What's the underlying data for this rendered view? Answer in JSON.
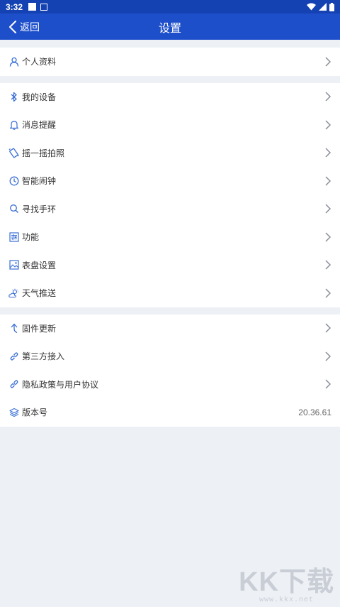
{
  "status_bar": {
    "time": "3:32"
  },
  "header": {
    "back_label": "返回",
    "title": "设置"
  },
  "groups": [
    {
      "items": [
        {
          "label": "个人资料",
          "icon": "person-icon"
        }
      ]
    },
    {
      "items": [
        {
          "label": "我的设备",
          "icon": "bluetooth-icon"
        },
        {
          "label": "消息提醒",
          "icon": "bell-icon"
        },
        {
          "label": "摇一摇拍照",
          "icon": "shake-phone-icon"
        },
        {
          "label": "智能闹钟",
          "icon": "clock-icon"
        },
        {
          "label": "寻找手环",
          "icon": "search-icon"
        },
        {
          "label": "功能",
          "icon": "sliders-icon"
        },
        {
          "label": "表盘设置",
          "icon": "picture-icon"
        },
        {
          "label": "天气推送",
          "icon": "weather-icon"
        }
      ]
    },
    {
      "items": [
        {
          "label": "固件更新",
          "icon": "update-arrow-icon"
        },
        {
          "label": "第三方接入",
          "icon": "link-icon"
        },
        {
          "label": "隐私政策与用户协议",
          "icon": "link-icon"
        },
        {
          "label": "版本号",
          "icon": "layers-icon",
          "value": "20.36.61"
        }
      ]
    }
  ],
  "watermark": {
    "text": "KK下载",
    "url": "www.kkx.net"
  },
  "colors": {
    "accent": "#1e4fcb",
    "status_bar": "#1542b3",
    "background": "#edf0f4",
    "icon": "#3a6fd6"
  }
}
